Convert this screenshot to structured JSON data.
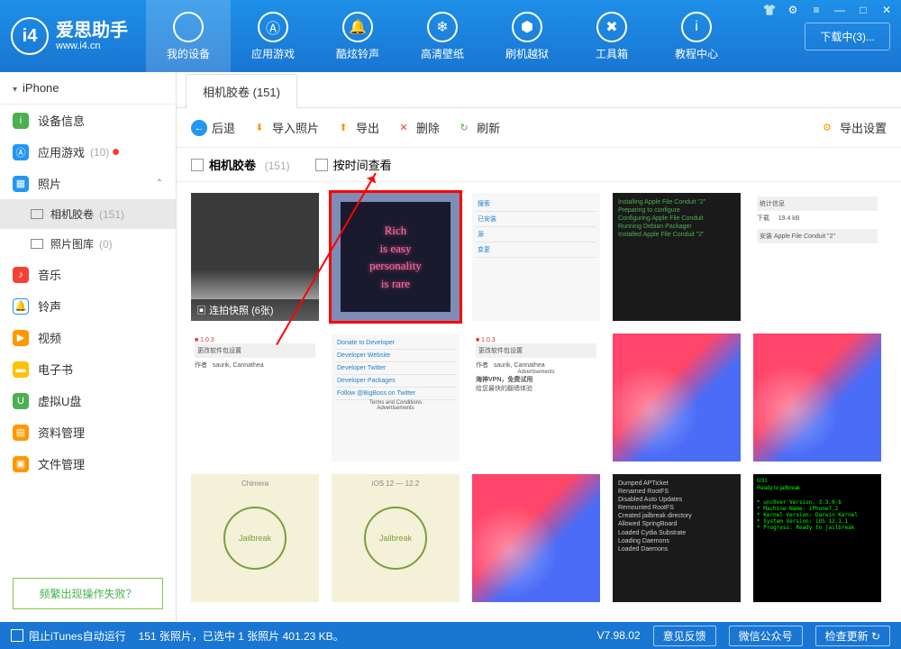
{
  "app": {
    "name": "爱思助手",
    "url": "www.i4.cn"
  },
  "win": {
    "download": "下载中(3)..."
  },
  "nav": [
    {
      "label": "我的设备",
      "icon": ""
    },
    {
      "label": "应用游戏",
      "icon": "Ⓐ"
    },
    {
      "label": "酷炫铃声",
      "icon": "🔔"
    },
    {
      "label": "高清壁纸",
      "icon": "❄"
    },
    {
      "label": "刷机越狱",
      "icon": "⬢"
    },
    {
      "label": "工具箱",
      "icon": "✖"
    },
    {
      "label": "教程中心",
      "icon": "i"
    }
  ],
  "sidebar": {
    "device": "iPhone",
    "items": [
      {
        "label": "设备信息",
        "color": "#4caf50",
        "icon": "i"
      },
      {
        "label": "应用游戏",
        "color": "#2196f3",
        "icon": "Ⓐ",
        "count": "(10)",
        "dot": true
      },
      {
        "label": "照片",
        "color": "#2196f3",
        "icon": "▦",
        "exp": true
      },
      {
        "label": "相机胶卷",
        "sub": true,
        "count": "(151)",
        "active": true
      },
      {
        "label": "照片图库",
        "sub": true,
        "count": "(0)"
      },
      {
        "label": "音乐",
        "color": "#f44336",
        "icon": "♪"
      },
      {
        "label": "铃声",
        "color": "#2196f3",
        "icon": "🔔"
      },
      {
        "label": "视频",
        "color": "#ff9800",
        "icon": "▶"
      },
      {
        "label": "电子书",
        "color": "#ffc107",
        "icon": "▬"
      },
      {
        "label": "虚拟U盘",
        "color": "#4caf50",
        "icon": "U"
      },
      {
        "label": "资料管理",
        "color": "#ff9800",
        "icon": "▤"
      },
      {
        "label": "文件管理",
        "color": "#ff9800",
        "icon": "▣"
      }
    ],
    "help": "频繁出现操作失败？"
  },
  "tab": {
    "label": "相机胶卷 (151)"
  },
  "toolbar": {
    "back": "后退",
    "import": "导入照片",
    "export": "导出",
    "delete": "删除",
    "refresh": "刷新",
    "settings": "导出设置"
  },
  "filter": {
    "roll": "相机胶卷",
    "rollcount": "(151)",
    "bytime": "按时间查看"
  },
  "thumbs": {
    "burst": "连拍快照 (6张)",
    "neon": "Rich\nis easy\npersonality\nis rare",
    "jb": "Jailbreak",
    "term1": "0/31\nReady to jailbreak",
    "vpn": "海神VPN，免费试用",
    "vpn2": "给您最快的翻墙体验"
  },
  "footer": {
    "itunes": "阻止iTunes自动运行",
    "status": "151 张照片，已选中 1 张照片 401.23 KB。",
    "version": "V7.98.02",
    "feedback": "意见反馈",
    "wechat": "微信公众号",
    "update": "检查更新"
  }
}
